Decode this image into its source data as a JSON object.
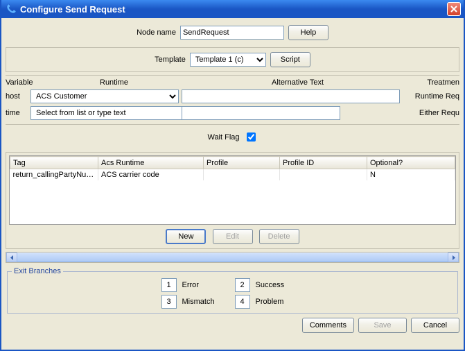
{
  "window": {
    "title": "Configure Send Request"
  },
  "header": {
    "node_name_label": "Node name",
    "node_name_value": "SendRequest",
    "help_label": "Help"
  },
  "template": {
    "label": "Template",
    "selected": "Template 1 (c)",
    "script_label": "Script"
  },
  "var_headers": {
    "variable": "Variable",
    "runtime": "Runtime",
    "alt_text": "Alternative Text",
    "treatment": "Treatmen"
  },
  "vars": [
    {
      "name": "host",
      "runtime_selected": "ACS Customer",
      "alt_text": "",
      "treatment": "Runtime Req"
    },
    {
      "name": "time",
      "runtime_selected": "Select from list or type text",
      "alt_text": "",
      "treatment": "Either Requ"
    }
  ],
  "wait_flag": {
    "label": "Wait Flag",
    "checked": true
  },
  "tag_table": {
    "headers": {
      "tag": "Tag",
      "acs_runtime": "Acs Runtime",
      "profile": "Profile",
      "profile_id": "Profile ID",
      "optional": "Optional?"
    },
    "rows": [
      {
        "tag": "return_callingPartyNum...",
        "acs_runtime": "ACS carrier code",
        "profile": "",
        "profile_id": "",
        "optional": "N"
      }
    ],
    "buttons": {
      "new": "New",
      "edit": "Edit",
      "delete": "Delete"
    }
  },
  "exit_branches": {
    "legend": "Exit Branches",
    "items": [
      {
        "num": "1",
        "label": "Error"
      },
      {
        "num": "2",
        "label": "Success"
      },
      {
        "num": "3",
        "label": "Mismatch"
      },
      {
        "num": "4",
        "label": "Problem"
      }
    ]
  },
  "footer": {
    "comments": "Comments",
    "save": "Save",
    "cancel": "Cancel"
  }
}
